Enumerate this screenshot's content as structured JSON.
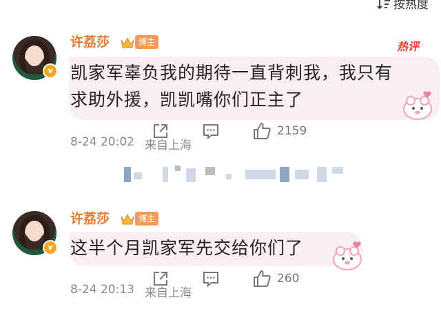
{
  "sort": {
    "label": "按热度"
  },
  "comments": [
    {
      "username": "许荔莎",
      "role_tag": "博主",
      "hot_tag": "热评",
      "text_line1": "凯家军辜负我的期待一直背刺我，我只有",
      "text_line2": "求助外援，凯凯嘴你们正主了",
      "time": "8-24 20:02",
      "location": "来自上海",
      "likes": "2159"
    },
    {
      "username": "许荔莎",
      "role_tag": "博主",
      "text_line1": "这半个月凯家军先交给你们了",
      "time": "8-24 20:13",
      "location": "来自上海",
      "likes": "260"
    }
  ],
  "icons": {
    "sort": "sort-icon",
    "share": "share-icon",
    "comment": "comment-icon",
    "like": "like-icon",
    "crown": "crown-icon",
    "verified": "verified-badge-icon"
  },
  "colors": {
    "username": "#e47a2c",
    "tag": "#f39c5a",
    "hot": "#e8432e",
    "bubble": "#fbeef1"
  }
}
